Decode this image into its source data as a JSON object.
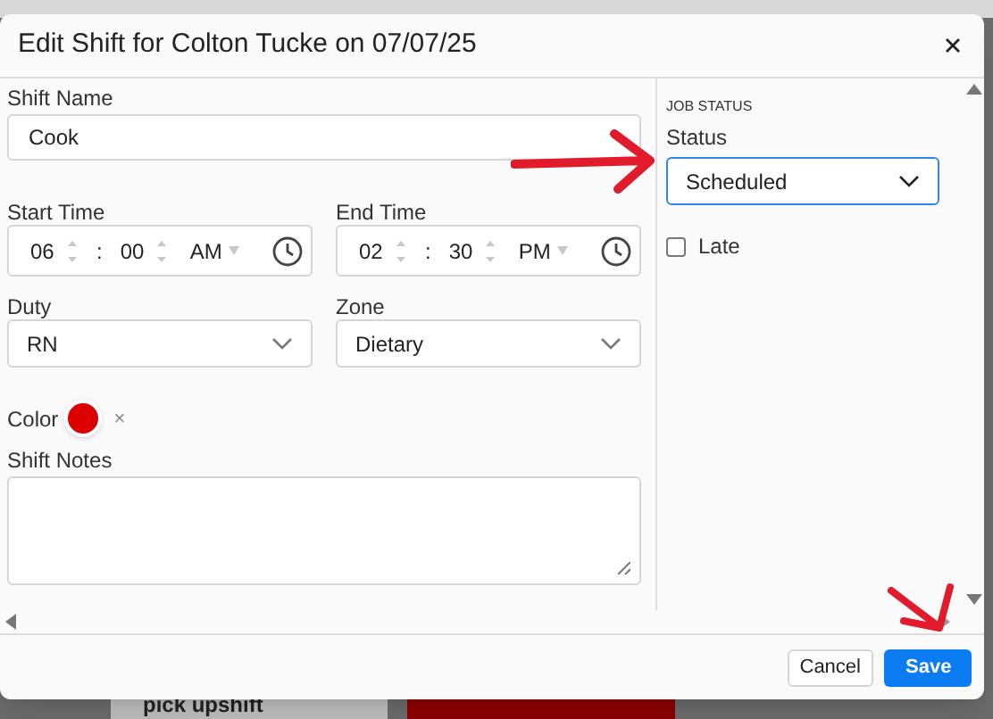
{
  "background": {
    "card_text": "pick upshift"
  },
  "dialog": {
    "title": "Edit Shift for Colton Tucke on 07/07/25",
    "shift_name": {
      "label": "Shift Name",
      "value": "Cook"
    },
    "times": [
      {
        "label": "Start Time",
        "hour": "06",
        "separator": ":",
        "minute": "00",
        "period": "AM"
      },
      {
        "label": "End Time",
        "hour": "02",
        "separator": ":",
        "minute": "30",
        "period": "PM"
      }
    ],
    "selects": [
      {
        "label": "Duty",
        "value": "RN"
      },
      {
        "label": "Zone",
        "value": "Dietary"
      }
    ],
    "color": {
      "label": "Color",
      "color": "#dd0000",
      "clear": "×"
    },
    "notes": {
      "label": "Shift Notes"
    },
    "job_status": {
      "heading": "JOB STATUS",
      "status_label": "Status",
      "status_value": "Scheduled",
      "status_focused": true,
      "late": {
        "label": "Late",
        "checked": false
      }
    },
    "buttons": [
      {
        "label": "Cancel",
        "kind": "secondary"
      },
      {
        "label": "Save",
        "kind": "primary"
      }
    ]
  }
}
